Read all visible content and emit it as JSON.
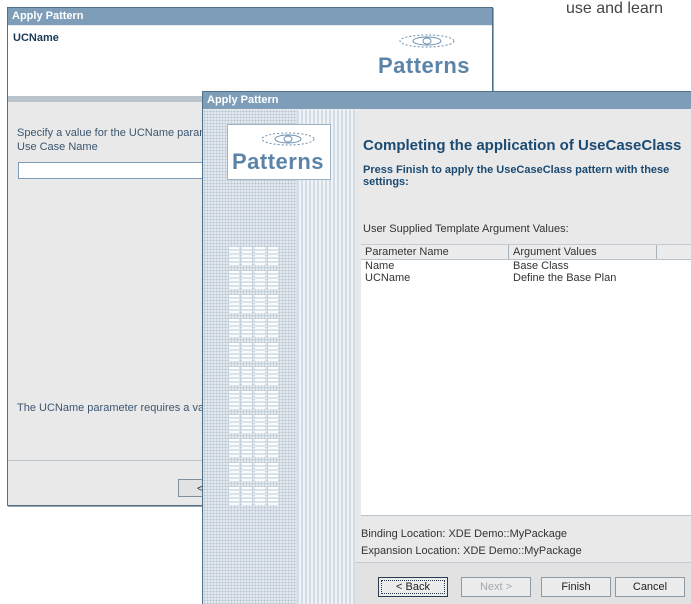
{
  "background_text": "use and learn",
  "back_window": {
    "title": "Apply Pattern",
    "header_title": "UCName",
    "logo_text": "Patterns",
    "prompt": "Specify a value for the UCName paramete",
    "field_label": "Use Case Name",
    "field_value": "",
    "requirement_text": "The UCName parameter requires a value c",
    "partial_button": "<"
  },
  "front_window": {
    "title": "Apply Pattern",
    "logo_text": "Patterns",
    "heading": "Completing the application of UseCaseClass",
    "subheading": "Press Finish to apply the UseCaseClass pattern with these settings:",
    "section_label": "User Supplied Template Argument Values:",
    "table": {
      "columns": [
        "Parameter Name",
        "Argument Values"
      ],
      "rows": [
        [
          "Name",
          "Base Class"
        ],
        [
          "UCName",
          "Define the Base Plan"
        ]
      ]
    },
    "binding_location": "Binding Location: XDE Demo::MyPackage",
    "expansion_location": "Expansion Location: XDE Demo::MyPackage",
    "buttons": {
      "back": "< Back",
      "next": "Next >",
      "finish": "Finish",
      "cancel": "Cancel"
    }
  },
  "colors": {
    "titlebar": "#7d9db8",
    "heading": "#1b4a72",
    "logo": "#5b84a8"
  }
}
